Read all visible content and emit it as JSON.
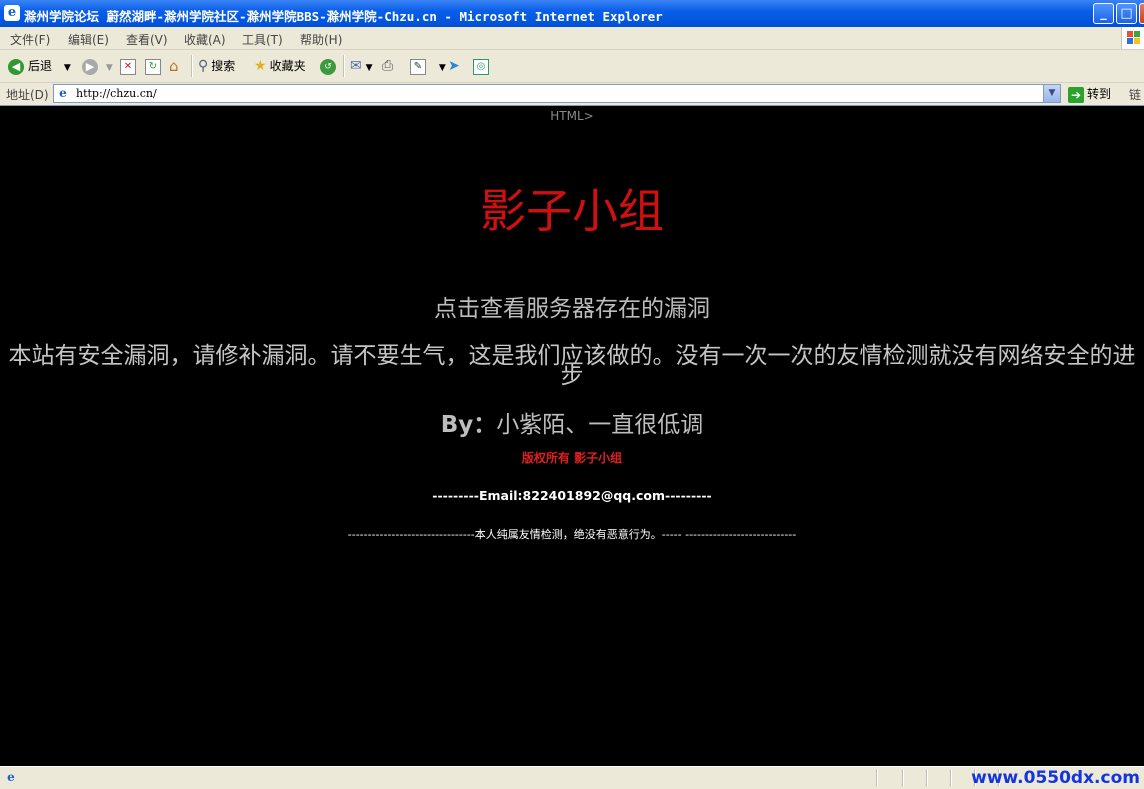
{
  "window": {
    "title": "滁州学院论坛 蔚然湖畔-滁州学院社区-滁州学院BBS-滁州学院-Chzu.cn - Microsoft Internet Explorer",
    "minimize_glyph": "_",
    "maximize_glyph": "□",
    "close_glyph": "×"
  },
  "menu": {
    "items": [
      "文件(F)",
      "编辑(E)",
      "查看(V)",
      "收藏(A)",
      "工具(T)",
      "帮助(H)"
    ]
  },
  "toolbar": {
    "back_label": "后退",
    "search_label": "搜索",
    "favorites_label": "收藏夹"
  },
  "address": {
    "label": "地址(D)",
    "url": "http://chzu.cn/",
    "go_label": "转到",
    "links_label": "链"
  },
  "page": {
    "html_fragment": "HTML>",
    "title": "影子小组",
    "sub_link": "点击查看服务器存在的漏洞",
    "notice": "本站有安全漏洞，请修补漏洞。请不要生气，这是我们应该做的。没有一次一次的友情检测就没有网络安全的进步",
    "by_prefix": "By：",
    "by_names": "小紫陌、一直很低调",
    "copyright": "版权所有 影子小组",
    "email_line": "---------Email:822401892@qq.com---------",
    "disclaimer": "--------------------------------本人纯属友情检测，绝没有恶意行为。----- ----------------------------"
  },
  "status": {
    "watermark": "www.0550dx.com"
  },
  "colors": {
    "title_red": "#d01010",
    "page_bg": "#000000",
    "watermark_blue": "#1235e0"
  }
}
